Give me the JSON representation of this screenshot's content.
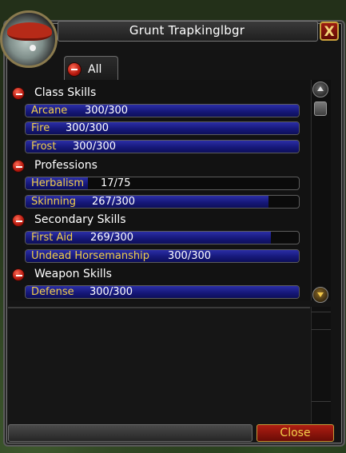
{
  "window": {
    "title": "Grunt Trapkinglbgr",
    "close_x_label": "X"
  },
  "filter_tab": {
    "label": "All"
  },
  "sections": [
    {
      "label": "Class Skills",
      "skills": [
        {
          "name": "Arcane",
          "value": "300/300",
          "current": 300,
          "max": 300
        },
        {
          "name": "Fire",
          "value": "300/300",
          "current": 300,
          "max": 300
        },
        {
          "name": "Frost",
          "value": "300/300",
          "current": 300,
          "max": 300
        }
      ]
    },
    {
      "label": "Professions",
      "skills": [
        {
          "name": "Herbalism",
          "value": "17/75",
          "current": 17,
          "max": 75
        },
        {
          "name": "Skinning",
          "value": "267/300",
          "current": 267,
          "max": 300
        }
      ]
    },
    {
      "label": "Secondary Skills",
      "skills": [
        {
          "name": "First Aid",
          "value": "269/300",
          "current": 269,
          "max": 300
        },
        {
          "name": "Undead Horsemanship",
          "value": "300/300",
          "current": 300,
          "max": 300
        }
      ]
    },
    {
      "label": "Weapon Skills",
      "skills": [
        {
          "name": "Defense",
          "value": "300/300",
          "current": 300,
          "max": 300
        }
      ]
    }
  ],
  "footer": {
    "close_button_label": "Close"
  },
  "colors": {
    "skill_name": "#f2cf4a",
    "bar_fill": "#1f2296",
    "close_button": "#9a170d"
  },
  "icons": {
    "portrait": "character-portrait",
    "collapse": "minus-icon",
    "scroll_up": "scroll-up-icon",
    "scroll_down": "scroll-down-icon"
  }
}
